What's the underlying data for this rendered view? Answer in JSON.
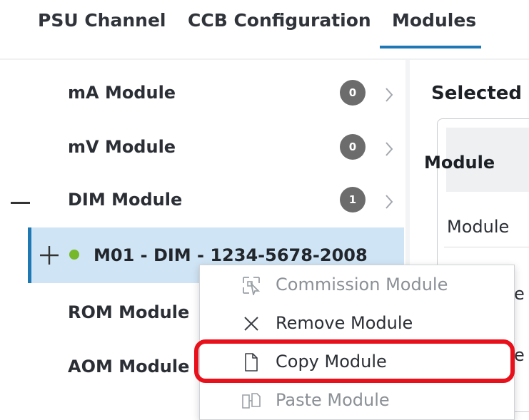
{
  "tabs": [
    {
      "label": "PSU Channel",
      "active": false
    },
    {
      "label": "CCB Configuration",
      "active": false
    },
    {
      "label": "Modules",
      "active": true
    }
  ],
  "modules": [
    {
      "label": "mA Module",
      "count": "0"
    },
    {
      "label": "mV Module",
      "count": "0"
    },
    {
      "label": "DIM Module",
      "count": "1",
      "expanded": true
    },
    {
      "label": "ROM Module"
    },
    {
      "label": "AOM Module"
    }
  ],
  "selected_device": {
    "label": "M01 - DIM - 1234-5678-2008",
    "status": "online",
    "status_color": "#76b82a"
  },
  "details": {
    "title": "Selected",
    "header": "Module",
    "row1": "Module",
    "fragment_1": "e",
    "fragment_2": "e"
  },
  "context_menu": {
    "items": [
      {
        "label": "Commission Module",
        "icon": "commission-icon",
        "enabled": false
      },
      {
        "label": "Remove Module",
        "icon": "close-icon",
        "enabled": true
      },
      {
        "label": "Copy Module",
        "icon": "document-icon",
        "enabled": true,
        "highlighted": true
      },
      {
        "label": "Paste Module",
        "icon": "paste-icon",
        "enabled": false
      }
    ]
  },
  "colors": {
    "accent": "#1e78b4",
    "highlight": "#e8101a",
    "selected_bg": "#cfe4f5",
    "badge": "#6c6c6c"
  }
}
